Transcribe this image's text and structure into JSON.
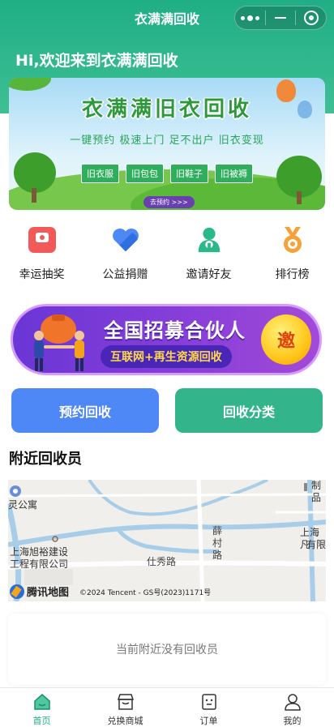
{
  "nav": {
    "title": "衣满满回收"
  },
  "header": {
    "greeting": "Hi,欢迎来到衣满满回收"
  },
  "banner": {
    "title": "衣满满旧衣回收",
    "subtitle": "一键预约  极速上门  足不出户  旧衣变现",
    "tags": [
      "旧衣服",
      "旧包包",
      "旧鞋子",
      "旧被褥"
    ],
    "cta": "去预约 >>>"
  },
  "quick_actions": [
    {
      "label": "幸运抽奖",
      "icon": "lottery-icon",
      "color": "#f25a5a"
    },
    {
      "label": "公益捐赠",
      "icon": "heart-icon",
      "color": "#4e88f6"
    },
    {
      "label": "邀请好友",
      "icon": "invite-friends-icon",
      "color": "#2bb88a"
    },
    {
      "label": "排行榜",
      "icon": "medal-icon",
      "color": "#f6a13a"
    }
  ],
  "recruit": {
    "title": "全国招募合伙人",
    "subtitle": "互联网+再生资源回收",
    "badge": "邀"
  },
  "buttons": {
    "book": "预约回收",
    "category": "回收分类"
  },
  "nearby": {
    "title": "附近回收员",
    "empty_text": "当前附近没有回收员"
  },
  "map": {
    "labels": {
      "apartment": "灵公寓",
      "company_line1": "上海旭裕建设",
      "company_line2": "工程有限公司",
      "road_shixiu": "仕秀路",
      "road_xuecun": "薛\n村\n路",
      "right_top": "制品",
      "right_mid1": "上海凡",
      "right_mid2": "有限"
    },
    "logo_text": "腾讯地图",
    "copyright": "©2024 Tencent - GS号(2023)1171号"
  },
  "tabs": [
    {
      "label": "首页",
      "icon": "home-icon",
      "active": true
    },
    {
      "label": "兑换商城",
      "icon": "shop-icon",
      "active": false
    },
    {
      "label": "订单",
      "icon": "order-icon",
      "active": false
    },
    {
      "label": "我的",
      "icon": "user-icon",
      "active": false
    }
  ],
  "colors": {
    "primary": "#1fae85",
    "blue_button": "#4e88f6",
    "green_button": "#34b48a"
  }
}
